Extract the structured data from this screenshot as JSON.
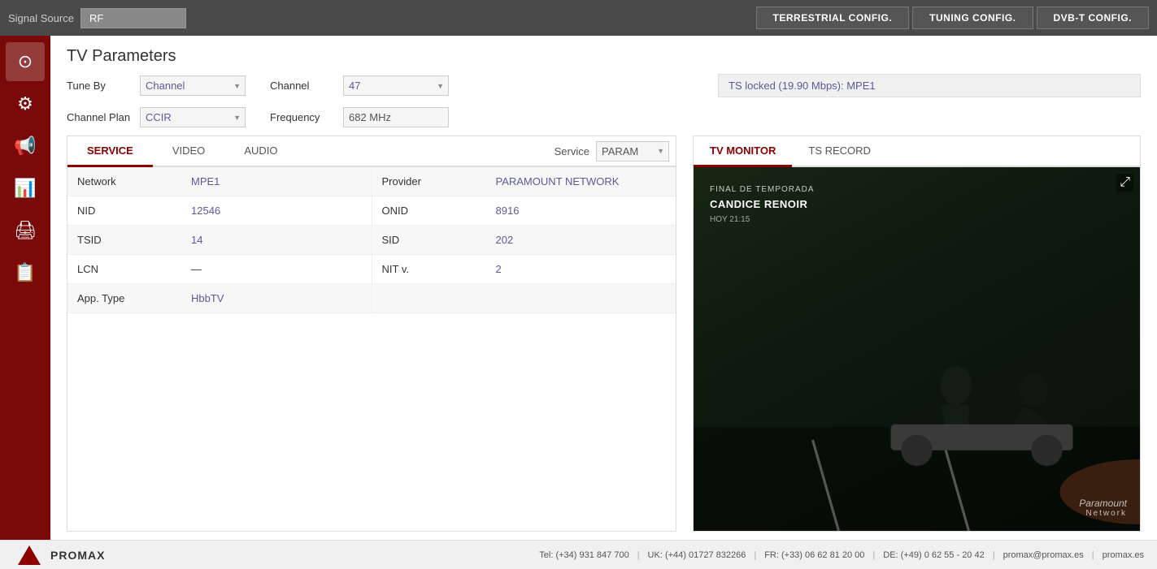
{
  "topbar": {
    "signal_source_label": "Signal Source",
    "signal_source_value": "RF",
    "btn_terrestrial": "TERRESTRIAL CONFIG.",
    "btn_tuning": "TUNING CONFIG.",
    "btn_dvbt": "DVB-T CONFIG."
  },
  "page": {
    "title": "TV Parameters"
  },
  "params": {
    "tune_by_label": "Tune By",
    "tune_by_value": "Channel",
    "channel_plan_label": "Channel Plan",
    "channel_plan_value": "CCIR",
    "channel_label": "Channel",
    "channel_value": "47",
    "frequency_label": "Frequency",
    "frequency_value": "682 MHz",
    "status": "TS locked (19.90 Mbps): MPE1"
  },
  "tabs": {
    "service_label": "SERVICE",
    "video_label": "VIDEO",
    "audio_label": "AUDIO",
    "service_field_label": "Service",
    "service_field_value": "PARAM"
  },
  "table": {
    "rows": [
      {
        "key": "Network",
        "val": "MPE1",
        "key2": "Provider",
        "val2": "PARAMOUNT NETWORK"
      },
      {
        "key": "NID",
        "val": "12546",
        "key2": "ONID",
        "val2": "8916"
      },
      {
        "key": "TSID",
        "val": "14",
        "key2": "SID",
        "val2": "202"
      },
      {
        "key": "LCN",
        "val": "—",
        "key2": "NIT v.",
        "val2": "2"
      },
      {
        "key": "App. Type",
        "val": "HbbTV",
        "key2": "",
        "val2": ""
      }
    ]
  },
  "monitor": {
    "tab_tv": "TV MONITOR",
    "tab_ts": "TS RECORD",
    "overlay_line1": "FINAL DE TEMPORADA",
    "overlay_line2": "CANDICE RENOIR",
    "overlay_line3": "HOY 21:15",
    "logo_line1": "Paramount",
    "logo_line2": "Network"
  },
  "sidebar": {
    "icons": [
      "⊙",
      "⚙",
      "📢",
      "📊",
      "🖨",
      "📋"
    ]
  },
  "footer": {
    "logo_text": "PROMAX",
    "tel_es": "Tel: (+34) 931 847 700",
    "tel_uk": "UK: (+44) 01727 832266",
    "tel_fr": "FR: (+33) 06 62 81 20 00",
    "tel_de": "DE: (+49) 0 62 55 - 20 42",
    "email": "promax@promax.es",
    "web": "promax.es"
  }
}
